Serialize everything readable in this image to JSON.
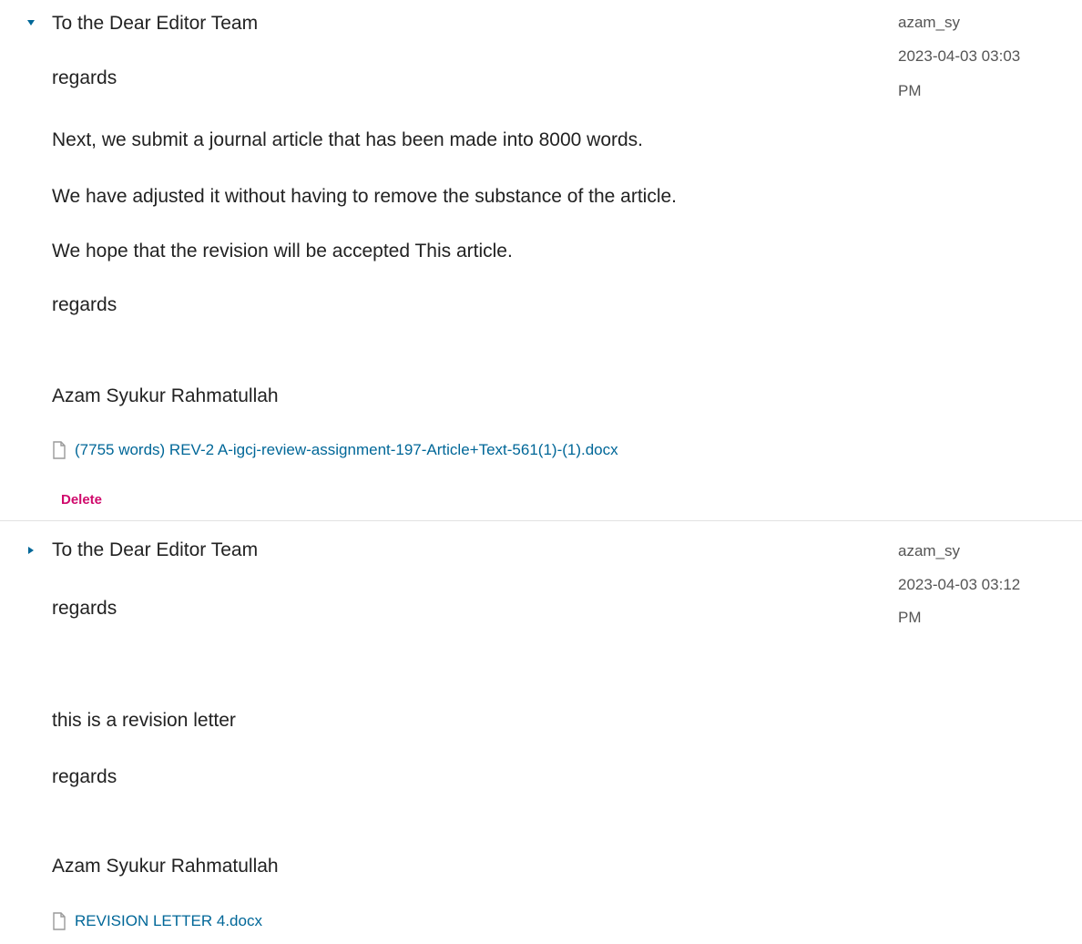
{
  "colors": {
    "text": "#222222",
    "meta_text": "#555555",
    "link": "#006798",
    "delete": "#d00a6c",
    "toggle": "#006798",
    "divider": "#e2e2e2"
  },
  "messages": [
    {
      "expanded": true,
      "toggle_icon": "caret-down-icon",
      "subject": "To the Dear Editor Team",
      "body": [
        "regards",
        "Next, we submit a journal article that has been made into 8000 words.",
        "We have adjusted it without having to remove the substance of the article.",
        "We hope that the revision will be accepted This article.",
        "regards",
        "Azam Syukur Rahmatullah"
      ],
      "author": "azam_sy",
      "date": "2023-04-03 03:03",
      "time_suffix": "PM",
      "attachment": {
        "icon": "file-icon",
        "label": "(7755 words) REV-2 A-igcj-review-assignment-197-Article+Text-561(1)-(1).docx"
      },
      "delete_label": "Delete"
    },
    {
      "expanded": false,
      "toggle_icon": "caret-right-icon",
      "subject": "To the Dear Editor Team",
      "body": [
        "regards",
        "this is a revision letter",
        "regards",
        "Azam Syukur Rahmatullah"
      ],
      "author": "azam_sy",
      "date": "2023-04-03 03:12",
      "time_suffix": "PM",
      "attachment": {
        "icon": "file-icon",
        "label": "REVISION LETTER 4.docx"
      }
    }
  ]
}
